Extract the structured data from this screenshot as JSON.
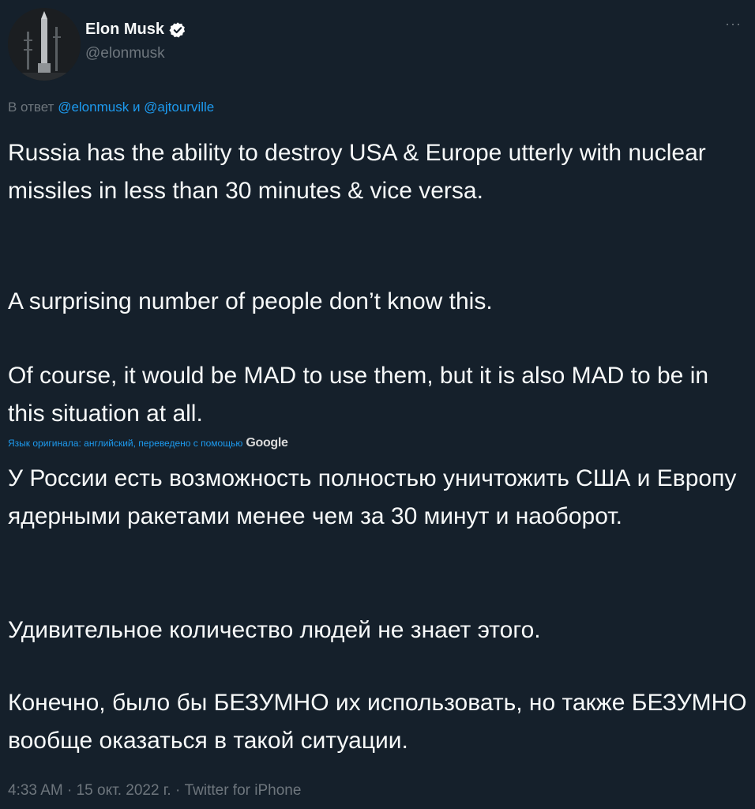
{
  "author": {
    "display_name": "Elon Musk",
    "handle": "@elonmusk",
    "verified": true
  },
  "more_label": "···",
  "reply": {
    "prefix": "В ответ",
    "mention1": "@elonmusk",
    "joiner": "и",
    "mention2": "@ajtourville"
  },
  "original_text": {
    "p1": "Russia has the ability to destroy USA & Europe utterly with nuclear missiles in less than 30 minutes & vice versa.",
    "p2": "A surprising number of people don’t know this.",
    "p3": "Of course, it would be MAD to use them, but it is also MAD to be in this situation at all."
  },
  "translation_note": {
    "text": "Язык оригинала: английский, переведено с помощью",
    "provider": "Google"
  },
  "translated_text": {
    "p1": "У России есть возможность полностью уничтожить США и Европу ядерными ракетами менее чем за 30 минут и наоборот.",
    "p2": "Удивительное количество людей не знает этого.",
    "p3": "Конечно, было бы БЕЗУМНО их использовать, но также БЕЗУМНО вообще оказаться в такой ситуации."
  },
  "meta": "4:33 AM · 15 окт. 2022 г. · Twitter for iPhone",
  "colors": {
    "background": "#15202b",
    "text": "#f7f9f9",
    "secondary": "#6e767d",
    "link": "#1d9bf0"
  }
}
